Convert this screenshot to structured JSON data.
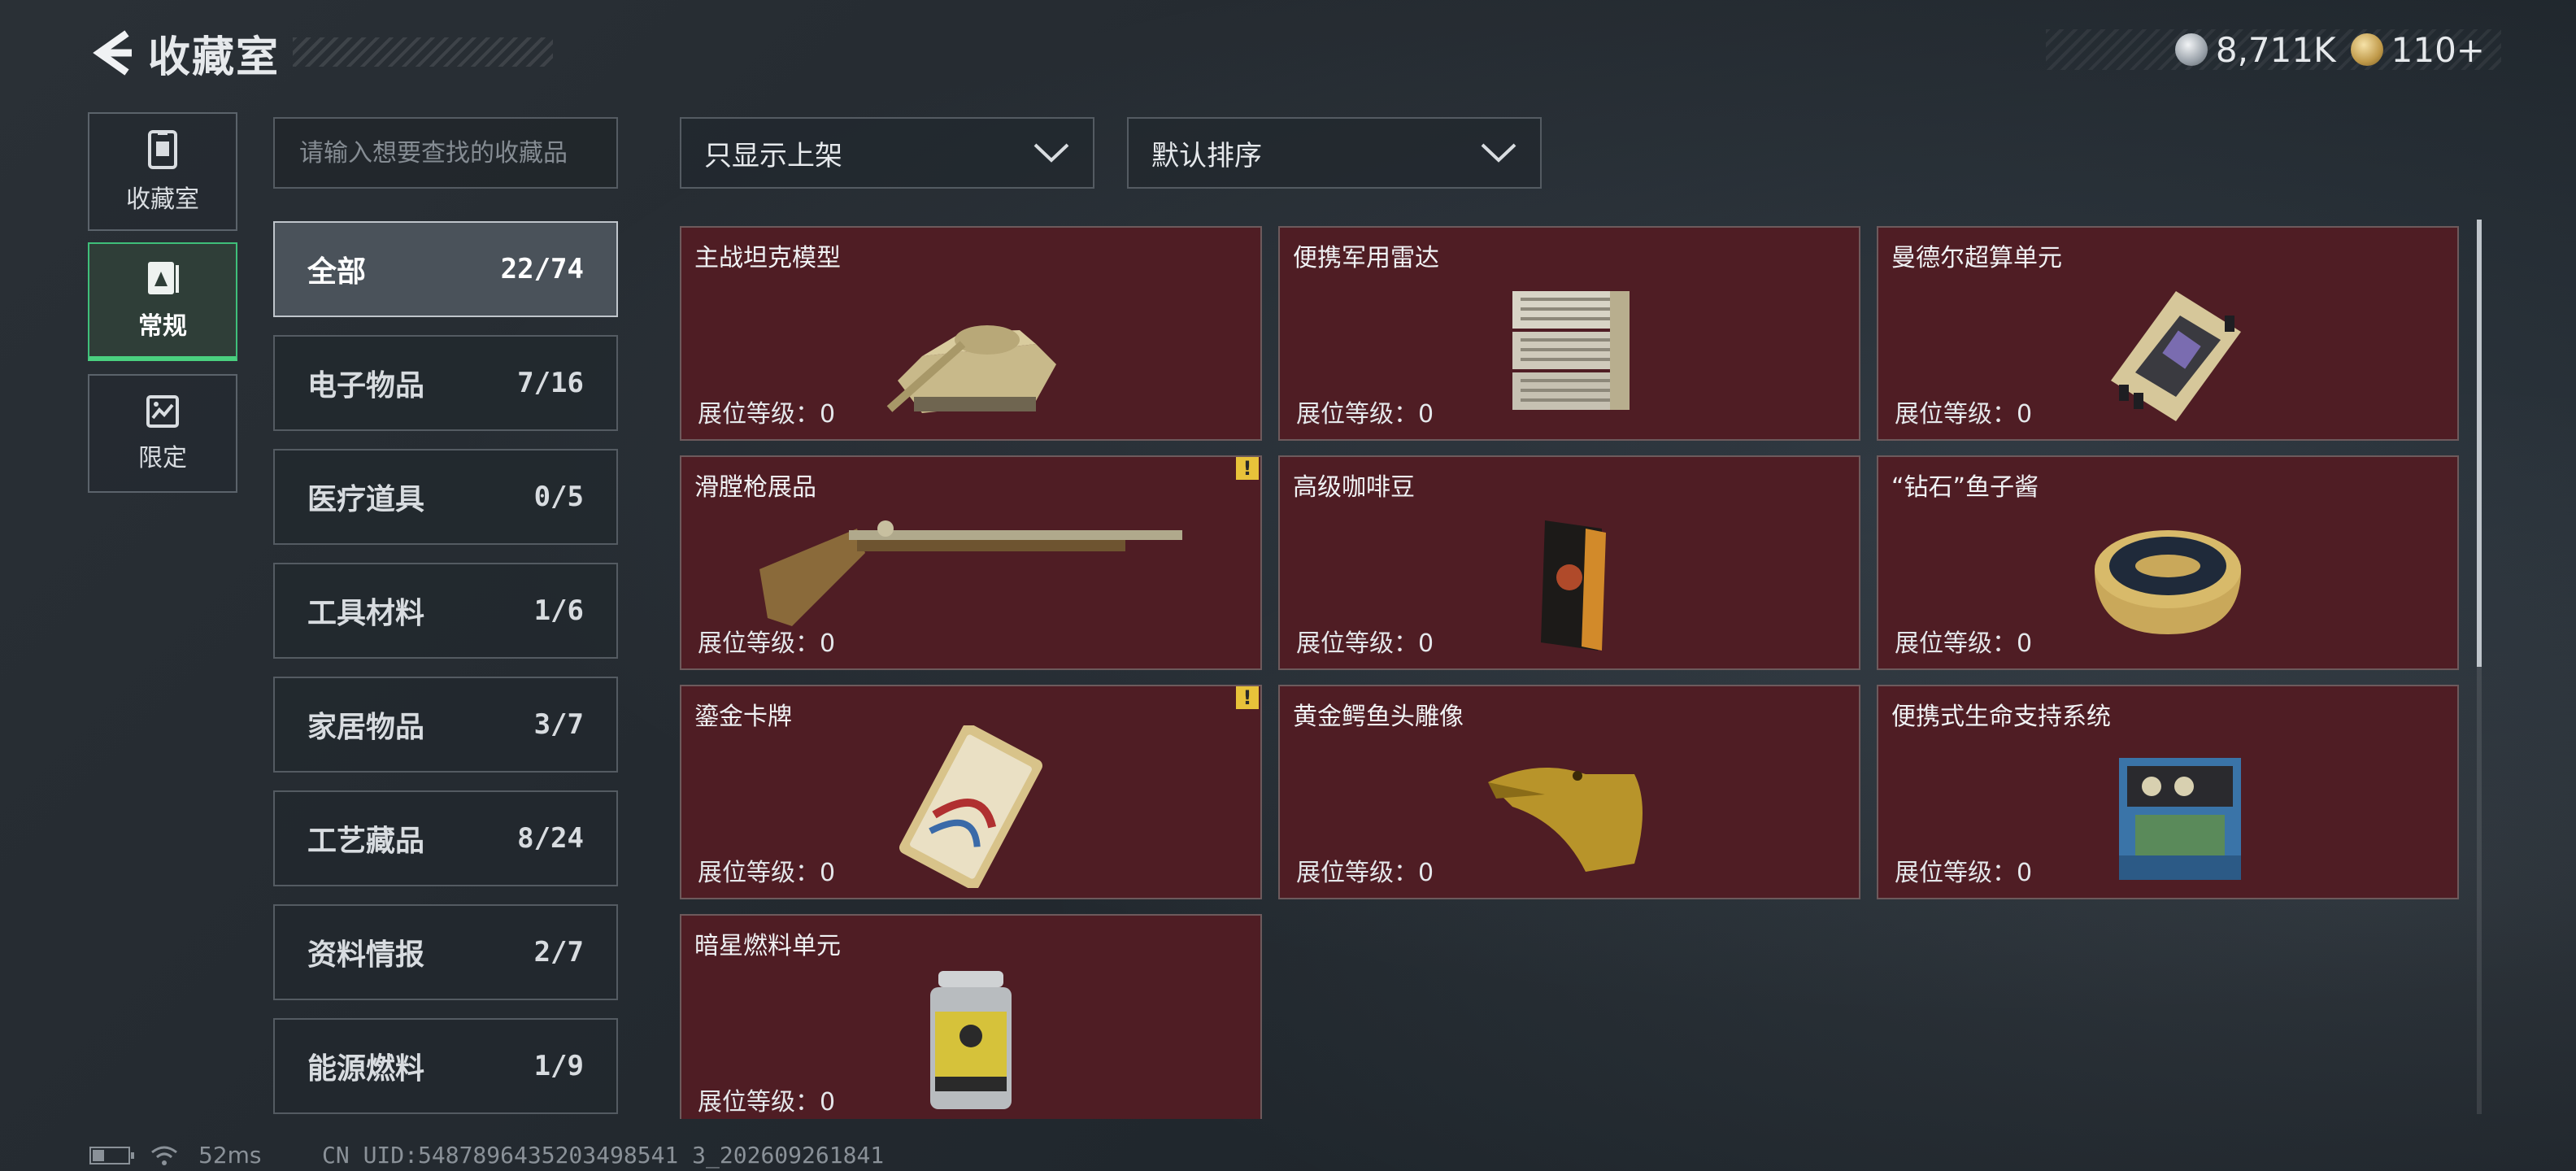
{
  "header": {
    "title": "收藏室"
  },
  "currency": [
    {
      "icon": "silver-coin-icon",
      "value": "8,711K"
    },
    {
      "icon": "gold-coin-icon",
      "value": "110+"
    }
  ],
  "left_tabs": [
    {
      "label": "收藏室",
      "icon": "collection-icon",
      "active": false
    },
    {
      "label": "常规",
      "icon": "regular-icon",
      "active": true
    },
    {
      "label": "限定",
      "icon": "limited-icon",
      "active": false
    }
  ],
  "search": {
    "placeholder": "请输入想要查找的收藏品"
  },
  "categories": [
    {
      "label": "全部",
      "count": "22/74"
    },
    {
      "label": "电子物品",
      "count": "7/16"
    },
    {
      "label": "医疗道具",
      "count": "0/5"
    },
    {
      "label": "工具材料",
      "count": "1/6"
    },
    {
      "label": "家居物品",
      "count": "3/7"
    },
    {
      "label": "工艺藏品",
      "count": "8/24"
    },
    {
      "label": "资料情报",
      "count": "2/7"
    },
    {
      "label": "能源燃料",
      "count": "1/9"
    }
  ],
  "filters": {
    "show_listed": "只显示上架",
    "sort": "默认排序"
  },
  "items": [
    {
      "name": "主战坦克模型",
      "level": "展位等级：0",
      "warning": false,
      "icon": "tank-model-icon"
    },
    {
      "name": "便携军用雷达",
      "level": "展位等级：0",
      "warning": false,
      "icon": "radar-icon"
    },
    {
      "name": "曼德尔超算单元",
      "level": "展位等级：0",
      "warning": false,
      "icon": "supercomputer-icon"
    },
    {
      "name": "滑膛枪展品",
      "level": "展位等级：0",
      "warning": true,
      "icon": "musket-icon"
    },
    {
      "name": "高级咖啡豆",
      "level": "展位等级：0",
      "warning": false,
      "icon": "coffee-bag-icon"
    },
    {
      "name": "“钻石”鱼子酱",
      "level": "展位等级：0",
      "warning": false,
      "icon": "caviar-tin-icon"
    },
    {
      "name": "鎏金卡牌",
      "level": "展位等级：0",
      "warning": true,
      "icon": "gilded-card-icon"
    },
    {
      "name": "黄金鳄鱼头雕像",
      "level": "展位等级：0",
      "warning": false,
      "icon": "crocodile-statue-icon"
    },
    {
      "name": "便携式生命支持系统",
      "level": "展位等级：0",
      "warning": false,
      "icon": "life-support-icon"
    },
    {
      "name": "暗星燃料单元",
      "level": "展位等级：0",
      "warning": false,
      "icon": "fuel-cell-icon"
    }
  ],
  "warning_mark": "!",
  "status_bar": {
    "ping": "52ms",
    "uid": "CN UID:5487896435203498541 3_202609261841"
  },
  "colors": {
    "card_bg": "#4f1d24",
    "active_tab": "#4ad07f",
    "warning": "#e8c23a"
  }
}
